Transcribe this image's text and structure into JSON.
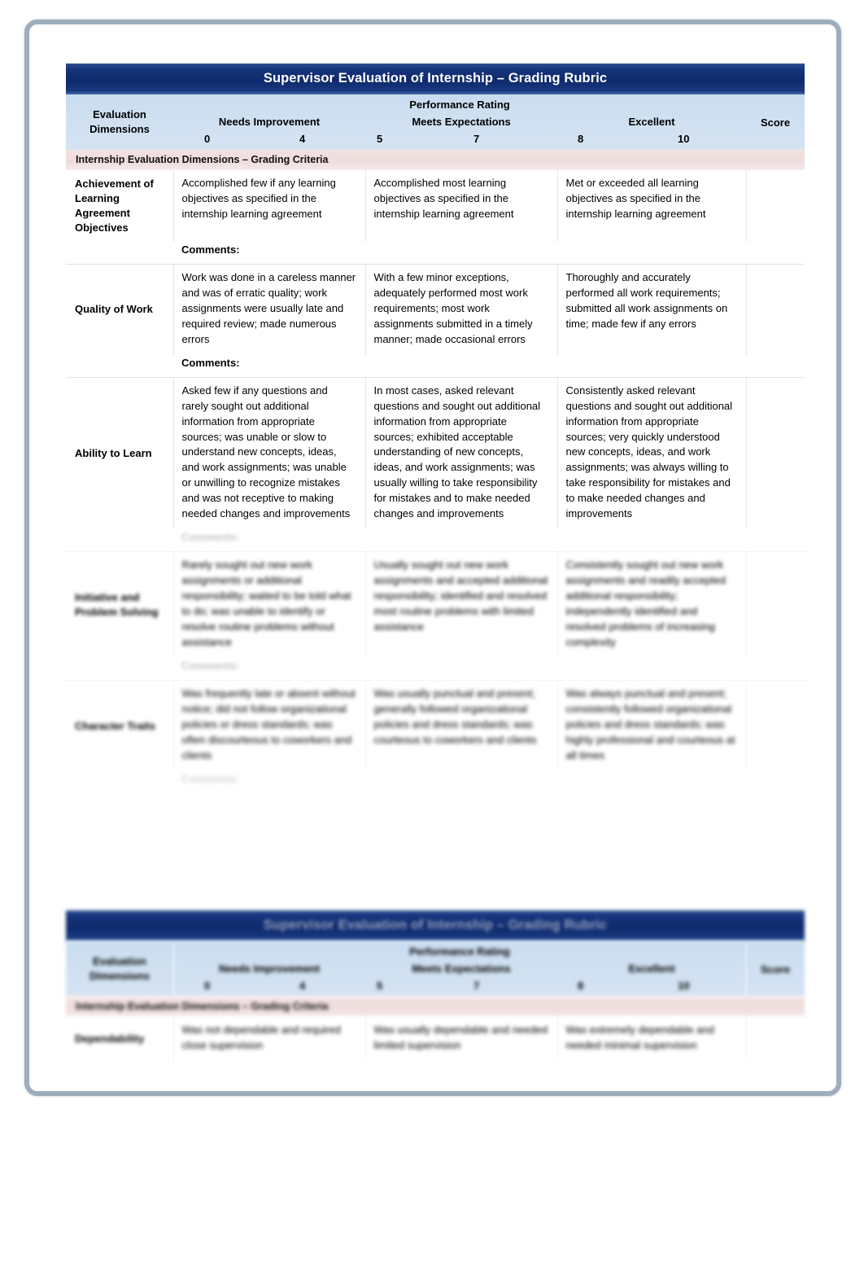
{
  "document": {
    "title": "Supervisor Evaluation of Internship – Grading Rubric",
    "criteria_band": "Internship Evaluation Dimensions – Grading Criteria",
    "comments_label": "Comments",
    "comments_colon": ":"
  },
  "header": {
    "dimensions_line1": "Evaluation",
    "dimensions_line2": "Dimensions",
    "performance_rating": "Performance Rating",
    "score": "Score",
    "bands": [
      {
        "label": "Needs Improvement",
        "low": "0",
        "high": "4"
      },
      {
        "label": "Meets Expectations",
        "low": "5",
        "high": "7"
      },
      {
        "label": "Excellent",
        "low": "8",
        "high": "10"
      }
    ]
  },
  "rows": [
    {
      "dimension": "Achievement of Learning Agreement Objectives",
      "needs_improvement": "Accomplished few if any learning objectives as specified in the internship learning agreement",
      "meets_expectations": "Accomplished most learning objectives as specified in the internship learning agreement",
      "excellent": "Met or exceeded all learning objectives as specified in the internship learning agreement",
      "score": "",
      "legible": true
    },
    {
      "dimension": "Quality of Work",
      "needs_improvement": "Work was done in a careless manner and was of erratic quality; work assignments were usually late and required review; made numerous errors",
      "meets_expectations": "With a few minor exceptions, adequately performed most work requirements; most work assignments submitted in a timely manner; made occasional errors",
      "excellent": "Thoroughly and accurately performed all work requirements; submitted all work assignments on time; made few if any errors",
      "score": "",
      "legible": true
    },
    {
      "dimension": "Ability to Learn",
      "needs_improvement": "Asked few if any questions and rarely sought out additional information from appropriate sources; was unable or slow to understand new concepts, ideas, and work assignments; was unable or unwilling to recognize mistakes and was not receptive to making needed changes and improvements",
      "meets_expectations": "In most cases, asked relevant questions and sought out additional information from appropriate sources; exhibited acceptable understanding of new concepts, ideas, and work assignments; was usually willing to take responsibility for mistakes and to make needed changes and improvements",
      "excellent": "Consistently asked relevant questions and sought out additional information from appropriate sources; very quickly understood new concepts, ideas, and work assignments; was always willing to take responsibility for mistakes and to make needed changes and improvements",
      "score": "",
      "legible": true
    },
    {
      "dimension": "Initiative and Problem Solving",
      "needs_improvement": "Rarely sought out new work assignments or additional responsibility; waited to be told what to do; was unable to identify or resolve routine problems without assistance",
      "meets_expectations": "Usually sought out new work assignments and accepted additional responsibility; identified and resolved most routine problems with limited assistance",
      "excellent": "Consistently sought out new work assignments and readily accepted additional responsibility; independently identified and resolved problems of increasing complexity",
      "score": "",
      "legible": false
    },
    {
      "dimension": "Character Traits",
      "needs_improvement": "Was frequently late or absent without notice; did not follow organizational policies or dress standards; was often discourteous to coworkers and clients",
      "meets_expectations": "Was usually punctual and present; generally followed organizational policies and dress standards; was courteous to coworkers and clients",
      "excellent": "Was always punctual and present; consistently followed organizational policies and dress standards; was highly professional and courteous at all times",
      "score": "",
      "legible": false
    }
  ],
  "continuation": {
    "title": "Supervisor Evaluation of Internship – Grading Rubric",
    "criteria_band": "Internship Evaluation Dimensions – Grading Criteria",
    "header": {
      "dimensions_line1": "Evaluation",
      "dimensions_line2": "Dimensions",
      "performance_rating": "Performance Rating",
      "score": "Score",
      "bands": [
        {
          "label": "Needs Improvement",
          "low": "0",
          "high": "4"
        },
        {
          "label": "Meets Expectations",
          "low": "5",
          "high": "7"
        },
        {
          "label": "Excellent",
          "low": "8",
          "high": "10"
        }
      ]
    },
    "row": {
      "dimension": "Dependability",
      "needs_improvement": "Was not dependable and required close supervision",
      "meets_expectations": "Was usually dependable and needed limited supervision",
      "excellent": "Was extremely dependable and needed minimal supervision",
      "score": ""
    }
  }
}
